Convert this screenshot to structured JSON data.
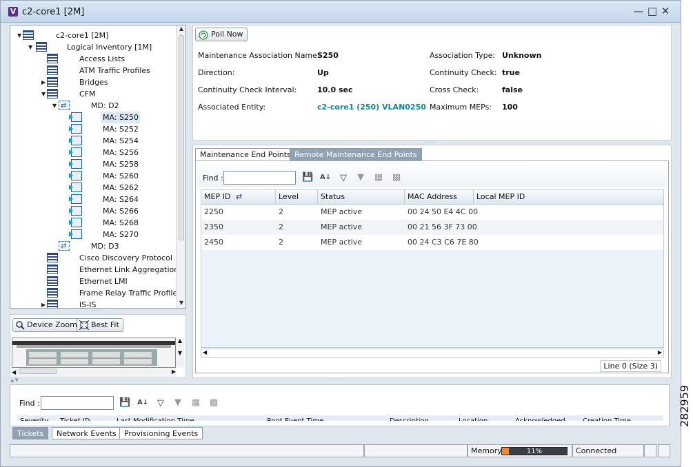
{
  "window": {
    "logo": "V",
    "title": "c2-core1 [2M]",
    "min_icon": "minimize-icon",
    "max_icon": "maximize-icon",
    "close_icon": "close-icon"
  },
  "tree": {
    "nodes": [
      {
        "label": "c2-core1 [2M]",
        "icon": "device-icon"
      },
      {
        "label": "Logical Inventory [1M]",
        "icon": "inventory-icon"
      },
      {
        "label": "Access Lists",
        "icon": "list-icon"
      },
      {
        "label": "ATM Traffic Profiles",
        "icon": "list-icon"
      },
      {
        "label": "Bridges",
        "icon": "list-icon"
      },
      {
        "label": "CFM",
        "icon": "list-icon"
      },
      {
        "label": "MD: D2",
        "icon": "domain-icon"
      },
      {
        "label": "MA: S250",
        "icon": "association-icon"
      },
      {
        "label": "MA: S252",
        "icon": "association-icon"
      },
      {
        "label": "MA: S254",
        "icon": "association-icon"
      },
      {
        "label": "MA: S256",
        "icon": "association-icon"
      },
      {
        "label": "MA: S258",
        "icon": "association-icon"
      },
      {
        "label": "MA: S260",
        "icon": "association-icon"
      },
      {
        "label": "MA: S262",
        "icon": "association-icon"
      },
      {
        "label": "MA: S264",
        "icon": "association-icon"
      },
      {
        "label": "MA: S266",
        "icon": "association-icon"
      },
      {
        "label": "MA: S268",
        "icon": "association-icon"
      },
      {
        "label": "MA: S270",
        "icon": "association-icon"
      },
      {
        "label": "MD: D3",
        "icon": "domain-icon"
      },
      {
        "label": "Cisco Discovery Protocol",
        "icon": "list-icon"
      },
      {
        "label": "Ethernet Link Aggregation",
        "icon": "list-icon"
      },
      {
        "label": "Ethernet LMI",
        "icon": "list-icon"
      },
      {
        "label": "Frame Relay Traffic Profiles",
        "icon": "list-icon"
      },
      {
        "label": "IS-IS",
        "icon": "list-icon"
      }
    ],
    "selected": "MA: S250"
  },
  "zoom": {
    "device_zoom": "Device Zoom",
    "best_fit": "Best Fit"
  },
  "details": {
    "poll_now": "Poll Now",
    "fields": [
      {
        "label": "Maintenance Association Name:",
        "value": "S250"
      },
      {
        "label": "Direction:",
        "value": "Up"
      },
      {
        "label": "Continuity Check Interval:",
        "value": "10.0 sec"
      },
      {
        "label": "Associated Entity:",
        "value": "c2-core1 (250) VLAN0250"
      },
      {
        "label": "Association Type:",
        "value": "Unknown"
      },
      {
        "label": "Continuity Check:",
        "value": "true"
      },
      {
        "label": "Cross Check:",
        "value": "false"
      },
      {
        "label": "Maximum MEPs:",
        "value": "100"
      }
    ]
  },
  "tabs": {
    "active": "Maintenance End Points",
    "inactive": "Remote Maintenance End Points"
  },
  "mep_table": {
    "find_label": "Find :",
    "find_value": "",
    "columns": [
      "MEP ID",
      "Level",
      "Status",
      "MAC Address",
      "Local MEP ID"
    ],
    "rows": [
      [
        "2250",
        "2",
        "MEP active",
        "00 24 50 E4 4C 00",
        ""
      ],
      [
        "2350",
        "2",
        "MEP active",
        "00 21 56 3F 73 00",
        ""
      ],
      [
        "2450",
        "2",
        "MEP active",
        "00 24 C3 C6 7E 80",
        ""
      ]
    ],
    "status_text": "Line 0 (Size 3)"
  },
  "bottom": {
    "find_label": "Find :",
    "columns": [
      "Severity",
      "Ticket ID",
      "Last Modification Time",
      "Root Event Time",
      "Description",
      "Location",
      "Acknowledged",
      "Creation Time"
    ],
    "tabs": [
      "Tickets",
      "Network Events",
      "Provisioning Events"
    ]
  },
  "statusbar": {
    "memory_label": "Memory:",
    "memory_percent": 11,
    "memory_text": "11%",
    "connection": "Connected"
  },
  "side_code": "282959"
}
